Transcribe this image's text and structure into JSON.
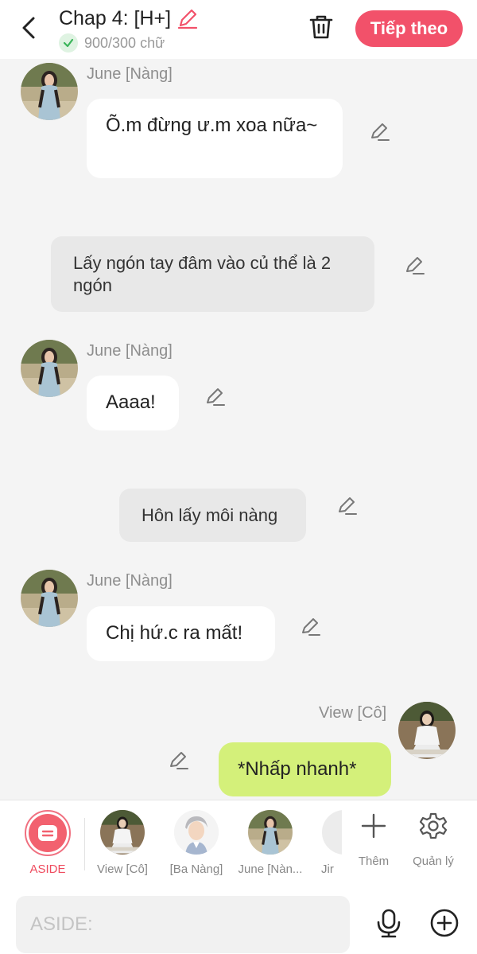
{
  "header": {
    "title": "Chap 4: [H+]",
    "word_count": "900/300 chữ",
    "next_label": "Tiếp theo"
  },
  "messages": [
    {
      "sender": "June [Nàng]",
      "text": "Õ.m đừng ư.m xoa nữa~"
    },
    {
      "narration": "Lấy ngón tay đâm vào củ thể là 2 ngón"
    },
    {
      "sender": "June [Nàng]",
      "text": "Aaaa!"
    },
    {
      "narration": "Hôn lấy môi nàng"
    },
    {
      "sender": "June [Nàng]",
      "text": "Chị hứ.c ra mất!"
    },
    {
      "sender": "View [Cô]",
      "text": "*Nhấp nhanh*"
    }
  ],
  "characters": {
    "aside": "ASIDE",
    "view": "View [Cô]",
    "ba_nang": "[Ba Nàng]",
    "june": "June [Nàn...",
    "partial": "Jir"
  },
  "tools": {
    "more": "Thêm",
    "manage": "Quản lý"
  },
  "input": {
    "placeholder": "ASIDE:"
  },
  "colors": {
    "accent": "#f2516a",
    "self_bubble": "#d4f07a",
    "narration_bg": "#e8e8e8"
  }
}
